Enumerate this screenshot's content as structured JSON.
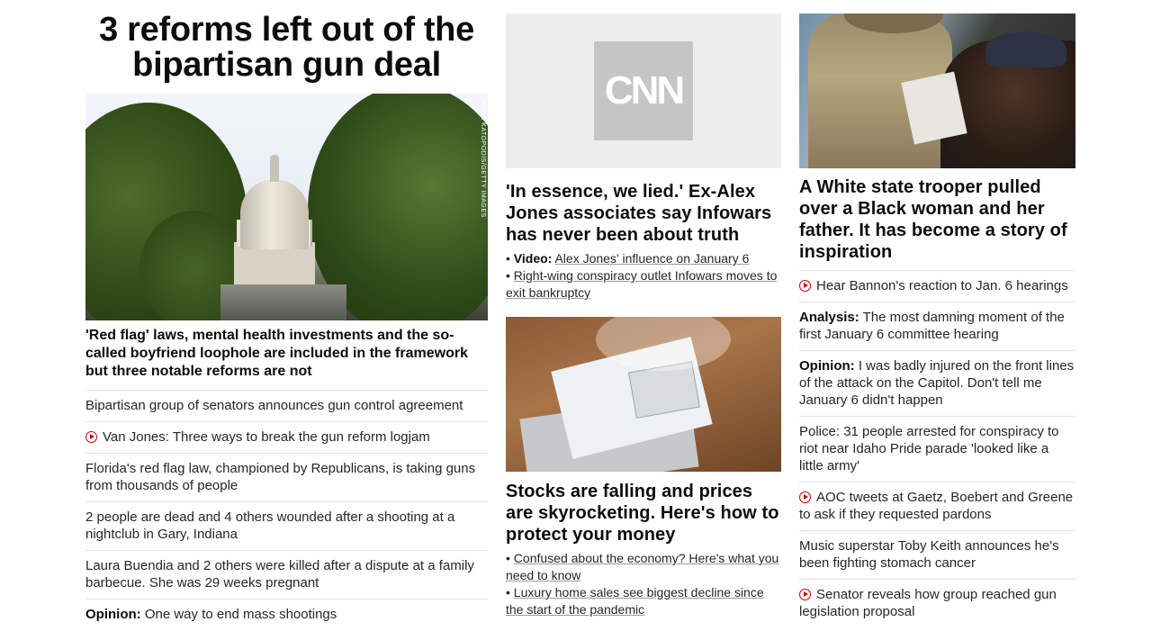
{
  "col1": {
    "title": "3 reforms left out of the bipartisan gun deal",
    "image_credit": "TASOS KATOPODIS/GETTY IMAGES",
    "lead_desc": "'Red flag' laws, mental health investments and the so-called boyfriend loophole are included in the framework but three notable reforms are not",
    "links": [
      {
        "text": "Bipartisan group of senators announces gun control agreement",
        "video": false,
        "prefix": ""
      },
      {
        "text": "Van Jones: Three ways to break the gun reform logjam",
        "video": true,
        "prefix": ""
      },
      {
        "text": "Florida's red flag law, championed by Republicans, is taking guns from thousands of people",
        "video": false,
        "prefix": ""
      },
      {
        "text": "2 people are dead and 4 others wounded after a shooting at a nightclub in Gary, Indiana",
        "video": false,
        "prefix": ""
      },
      {
        "text": "Laura Buendia and 2 others were killed after a dispute at a family barbecue. She was 29 weeks pregnant",
        "video": false,
        "prefix": ""
      },
      {
        "text": "One way to end mass shootings",
        "video": false,
        "prefix": "Opinion:"
      }
    ]
  },
  "col2": {
    "cnn_logo": "CNN",
    "story1_title": "'In essence, we lied.' Ex-Alex Jones associates say Infowars has never been about truth",
    "story1_links": [
      {
        "prefix": "Video:",
        "text": "Alex Jones' influence on January 6"
      },
      {
        "prefix": "",
        "text": "Right-wing conspiracy outlet Infowars moves to exit bankruptcy"
      }
    ],
    "story2_title": "Stocks are falling and prices are skyrocketing. Here's how to protect your money",
    "story2_links": [
      {
        "prefix": "",
        "text": "Confused about the economy? Here's what you need to know"
      },
      {
        "prefix": "",
        "text": "Luxury home sales see biggest decline since the start of the pandemic"
      }
    ]
  },
  "col3": {
    "title": "A White state trooper pulled over a Black woman and her father. It has become a story of inspiration",
    "links": [
      {
        "text": "Hear Bannon's reaction to Jan. 6 hearings",
        "video": true,
        "prefix": ""
      },
      {
        "text": "The most damning moment of the first January 6 committee hearing",
        "video": false,
        "prefix": "Analysis:"
      },
      {
        "text": "I was badly injured on the front lines of the attack on the Capitol. Don't tell me January 6 didn't happen",
        "video": false,
        "prefix": "Opinion:"
      },
      {
        "text": "Police: 31 people arrested for conspiracy to riot near Idaho Pride parade 'looked like a little army'",
        "video": false,
        "prefix": ""
      },
      {
        "text": "AOC tweets at Gaetz, Boebert and Greene to ask if they requested pardons",
        "video": true,
        "prefix": ""
      },
      {
        "text": "Music superstar Toby Keith announces he's been fighting stomach cancer",
        "video": false,
        "prefix": ""
      },
      {
        "text": "Senator reveals how group reached gun legislation proposal",
        "video": true,
        "prefix": ""
      }
    ]
  },
  "colors": {
    "play_red": "#cc0000",
    "divider": "#e3e3e3",
    "text": "#0c0c0c"
  }
}
